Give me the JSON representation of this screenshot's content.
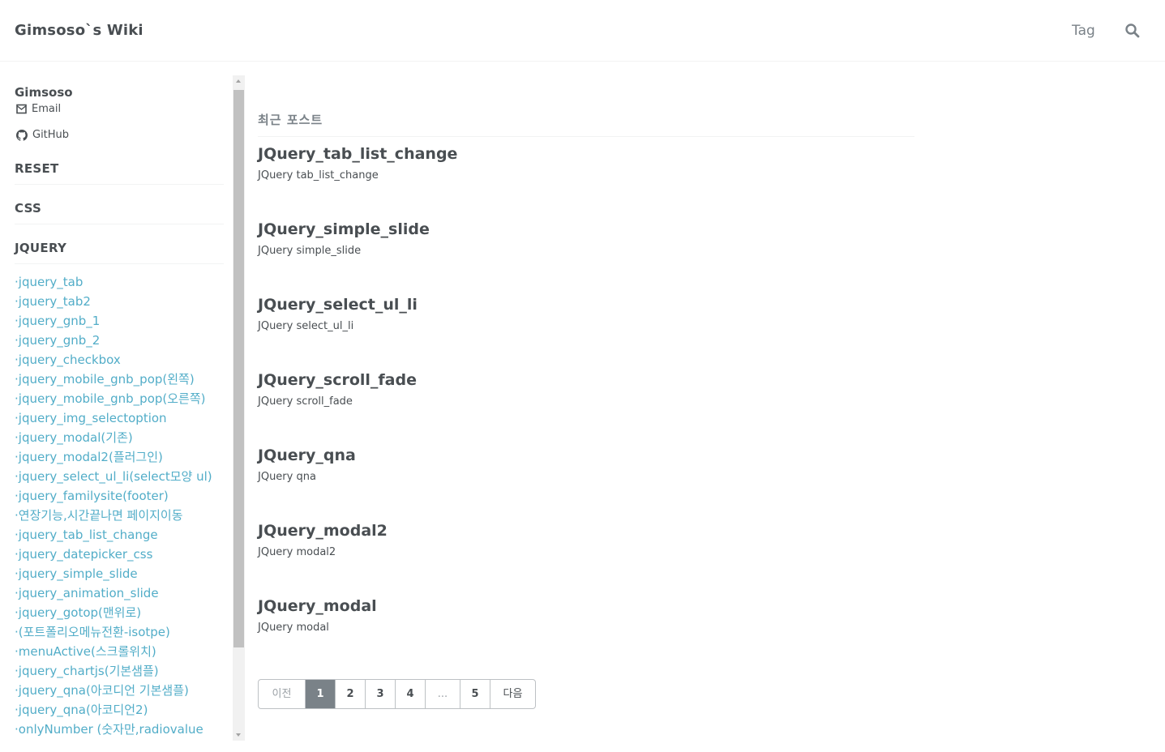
{
  "header": {
    "site_title": "Gimsoso`s Wiki",
    "nav_tag": "Tag",
    "search_icon": "search-icon"
  },
  "sidebar": {
    "author_name": "Gimsoso",
    "email_label": "Email",
    "github_label": "GitHub",
    "sections": [
      "RESET",
      "CSS",
      "JQUERY"
    ],
    "jquery_items": [
      "jquery_tab",
      "jquery_tab2",
      "jquery_gnb_1",
      "jquery_gnb_2",
      "jquery_checkbox",
      "jquery_mobile_gnb_pop(왼쪽)",
      "jquery_mobile_gnb_pop(오른쪽)",
      "jquery_img_selectoption",
      "jquery_modal(기존)",
      "jquery_modal2(플러그인)",
      "jquery_select_ul_li(select모양 ul)",
      "jquery_familysite(footer)",
      "연장기능,시간끝나면 페이지이동",
      "jquery_tab_list_change",
      "jquery_datepicker_css",
      "jquery_simple_slide",
      "jquery_animation_slide",
      "jquery_gotop(맨위로)",
      "(포트폴리오메뉴전환-isotpe)",
      "menuActive(스크롤위치)",
      "jquery_chartjs(기본샘플)",
      "jquery_qna(아코디언 기본샘플)",
      "jquery_qna(아코디언2)",
      "onlyNumber (숫자만,radiovalue"
    ]
  },
  "main": {
    "subtitle": "최근 포스트",
    "posts": [
      {
        "title": "JQuery_tab_list_change",
        "excerpt": "JQuery tab_list_change"
      },
      {
        "title": "JQuery_simple_slide",
        "excerpt": "JQuery simple_slide"
      },
      {
        "title": "JQuery_select_ul_li",
        "excerpt": "JQuery select_ul_li"
      },
      {
        "title": "JQuery_scroll_fade",
        "excerpt": "JQuery scroll_fade"
      },
      {
        "title": "JQuery_qna",
        "excerpt": "JQuery qna"
      },
      {
        "title": "JQuery_modal2",
        "excerpt": "JQuery modal2"
      },
      {
        "title": "JQuery_modal",
        "excerpt": "JQuery modal"
      }
    ]
  },
  "pagination": {
    "prev_label": "이전",
    "pages": [
      "1",
      "2",
      "3",
      "4"
    ],
    "ellipsis": "...",
    "last_page": "5",
    "next_label": "다음",
    "current_page": "1"
  },
  "colors": {
    "link": "#52adc8",
    "title": "#494e52",
    "muted": "#7a8288",
    "current_page_bg": "#7a8288"
  }
}
